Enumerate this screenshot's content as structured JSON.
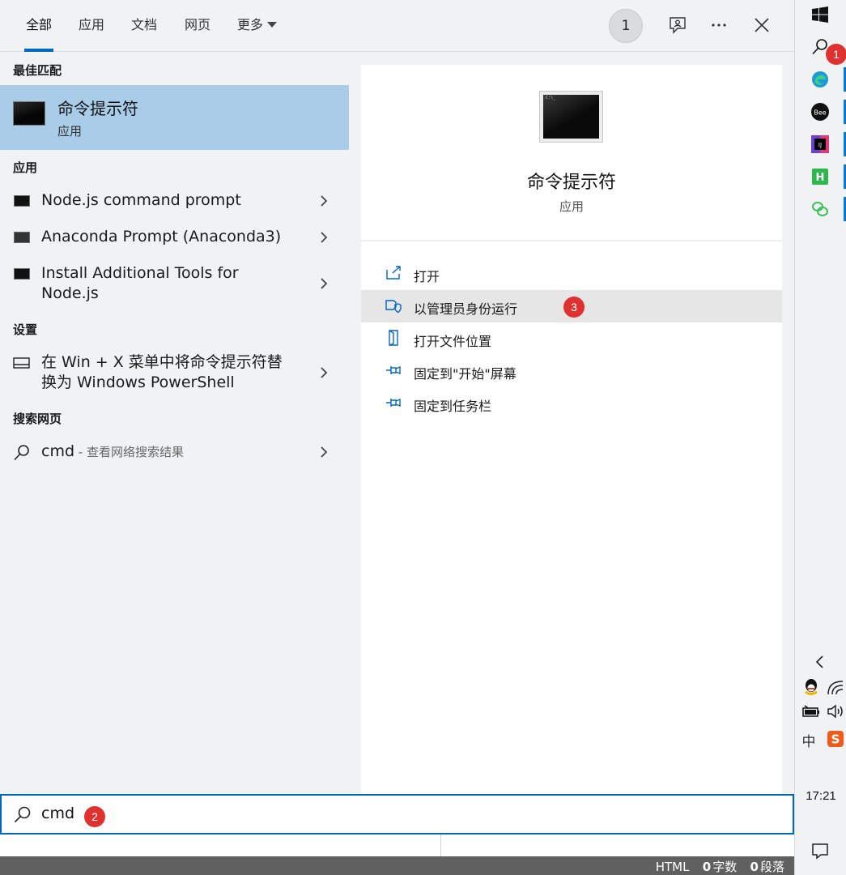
{
  "tabs": [
    {
      "label": "全部",
      "active": true
    },
    {
      "label": "应用",
      "active": false
    },
    {
      "label": "文档",
      "active": false
    },
    {
      "label": "网页",
      "active": false
    },
    {
      "label": "更多",
      "active": false
    }
  ],
  "header": {
    "count_badge": "1",
    "icons": [
      "feedback-icon",
      "more-icon",
      "close-icon"
    ]
  },
  "best_match": {
    "section_title": "最佳匹配",
    "title": "命令提示符",
    "subtitle": "应用",
    "highlight_color": "#a9cde8"
  },
  "apps": {
    "section_title": "应用",
    "items": [
      {
        "label": "Node.js command prompt"
      },
      {
        "label": "Anaconda Prompt (Anaconda3)"
      },
      {
        "label_line1": "Install Additional Tools for",
        "label_line2": "Node.js"
      }
    ]
  },
  "settings": {
    "section_title": "设置",
    "items": [
      {
        "label_line1": "在 Win + X 菜单中将命令提示符替",
        "label_line2": "换为 Windows PowerShell"
      }
    ]
  },
  "web": {
    "section_title": "搜索网页",
    "query": "cmd",
    "suffix": " - 查看网络搜索结果"
  },
  "detail": {
    "title": "命令提示符",
    "subtitle": "应用",
    "actions": [
      {
        "label": "打开",
        "icon": "open-window-icon"
      },
      {
        "label": "以管理员身份运行",
        "icon": "shield-icon",
        "hovered": true
      },
      {
        "label": "打开文件位置",
        "icon": "folder-location-icon"
      },
      {
        "label": "固定到\"开始\"屏幕",
        "icon": "pin-icon"
      },
      {
        "label": "固定到任务栏",
        "icon": "pin-icon"
      }
    ]
  },
  "search": {
    "value": "cmd",
    "accent": "#0067c0"
  },
  "annotations": {
    "step1": "1",
    "step2": "2",
    "step3": "3",
    "color": "#e03131"
  },
  "status_bar": {
    "mode": "HTML",
    "char_count": "0",
    "char_label": "字数",
    "para_count": "0",
    "para_label": "段落"
  },
  "taskbar": {
    "clock": "17:21",
    "ime": "中"
  }
}
